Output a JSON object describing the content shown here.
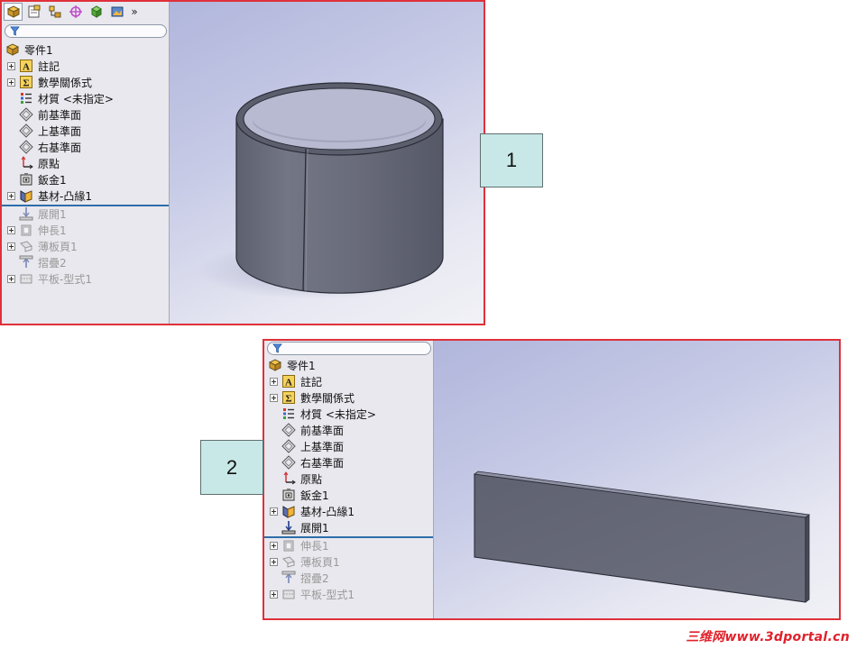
{
  "screen1": {
    "toolbar": {
      "icons": [
        "feature-manager-icon",
        "property-manager-icon",
        "configuration-manager-icon",
        "dimxpert-icon",
        "display-manager-icon",
        "cam-icon"
      ],
      "more": "»"
    },
    "tree": {
      "root": "零件1",
      "items": [
        {
          "label": "註記",
          "icon": "annotation-icon",
          "expandable": true,
          "suppressed": false
        },
        {
          "label": "數學關係式",
          "icon": "equations-icon",
          "expandable": true,
          "suppressed": false
        },
        {
          "label": "材質 <未指定>",
          "icon": "material-icon",
          "expandable": false,
          "suppressed": false
        },
        {
          "label": "前基準面",
          "icon": "plane-icon",
          "expandable": false,
          "suppressed": false
        },
        {
          "label": "上基準面",
          "icon": "plane-icon",
          "expandable": false,
          "suppressed": false
        },
        {
          "label": "右基準面",
          "icon": "plane-icon",
          "expandable": false,
          "suppressed": false
        },
        {
          "label": "原點",
          "icon": "origin-icon",
          "expandable": false,
          "suppressed": false
        },
        {
          "label": "鈑金1",
          "icon": "sheetmetal-icon",
          "expandable": false,
          "suppressed": false
        },
        {
          "label": "基材-凸緣1",
          "icon": "base-flange-icon",
          "expandable": true,
          "suppressed": false
        }
      ],
      "rolled_back": [
        {
          "label": "展開1",
          "icon": "unfold-icon",
          "expandable": false
        },
        {
          "label": "伸長1",
          "icon": "extrude-icon",
          "expandable": true
        },
        {
          "label": "薄板頁1",
          "icon": "tab-icon",
          "expandable": true
        },
        {
          "label": "摺疊2",
          "icon": "fold-icon",
          "expandable": false
        },
        {
          "label": "平板-型式1",
          "icon": "flat-pattern-icon",
          "expandable": true
        }
      ]
    },
    "callout": "1"
  },
  "screen2": {
    "tree": {
      "root": "零件1",
      "items": [
        {
          "label": "註記",
          "icon": "annotation-icon",
          "expandable": true
        },
        {
          "label": "數學關係式",
          "icon": "equations-icon",
          "expandable": true
        },
        {
          "label": "材質 <未指定>",
          "icon": "material-icon",
          "expandable": false
        },
        {
          "label": "前基準面",
          "icon": "plane-icon",
          "expandable": false
        },
        {
          "label": "上基準面",
          "icon": "plane-icon",
          "expandable": false
        },
        {
          "label": "右基準面",
          "icon": "plane-icon",
          "expandable": false
        },
        {
          "label": "原點",
          "icon": "origin-icon",
          "expandable": false
        },
        {
          "label": "鈑金1",
          "icon": "sheetmetal-icon",
          "expandable": false
        },
        {
          "label": "基材-凸緣1",
          "icon": "base-flange-icon",
          "expandable": true
        },
        {
          "label": "展開1",
          "icon": "unfold-icon",
          "expandable": false
        }
      ],
      "rolled_back": [
        {
          "label": "伸長1",
          "icon": "extrude-icon",
          "expandable": true
        },
        {
          "label": "薄板頁1",
          "icon": "tab-icon",
          "expandable": true
        },
        {
          "label": "摺疊2",
          "icon": "fold-icon",
          "expandable": false
        },
        {
          "label": "平板-型式1",
          "icon": "flat-pattern-icon",
          "expandable": true
        }
      ]
    },
    "callout": "2"
  },
  "watermark": "三维网www.3dportal.cn",
  "colors": {
    "frame_border": "#e0303a",
    "rollback_bar": "#2f6eaa",
    "callout_fill": "#c8e8e8",
    "model_body": "#6e7180",
    "watermark": "#e0212b"
  }
}
